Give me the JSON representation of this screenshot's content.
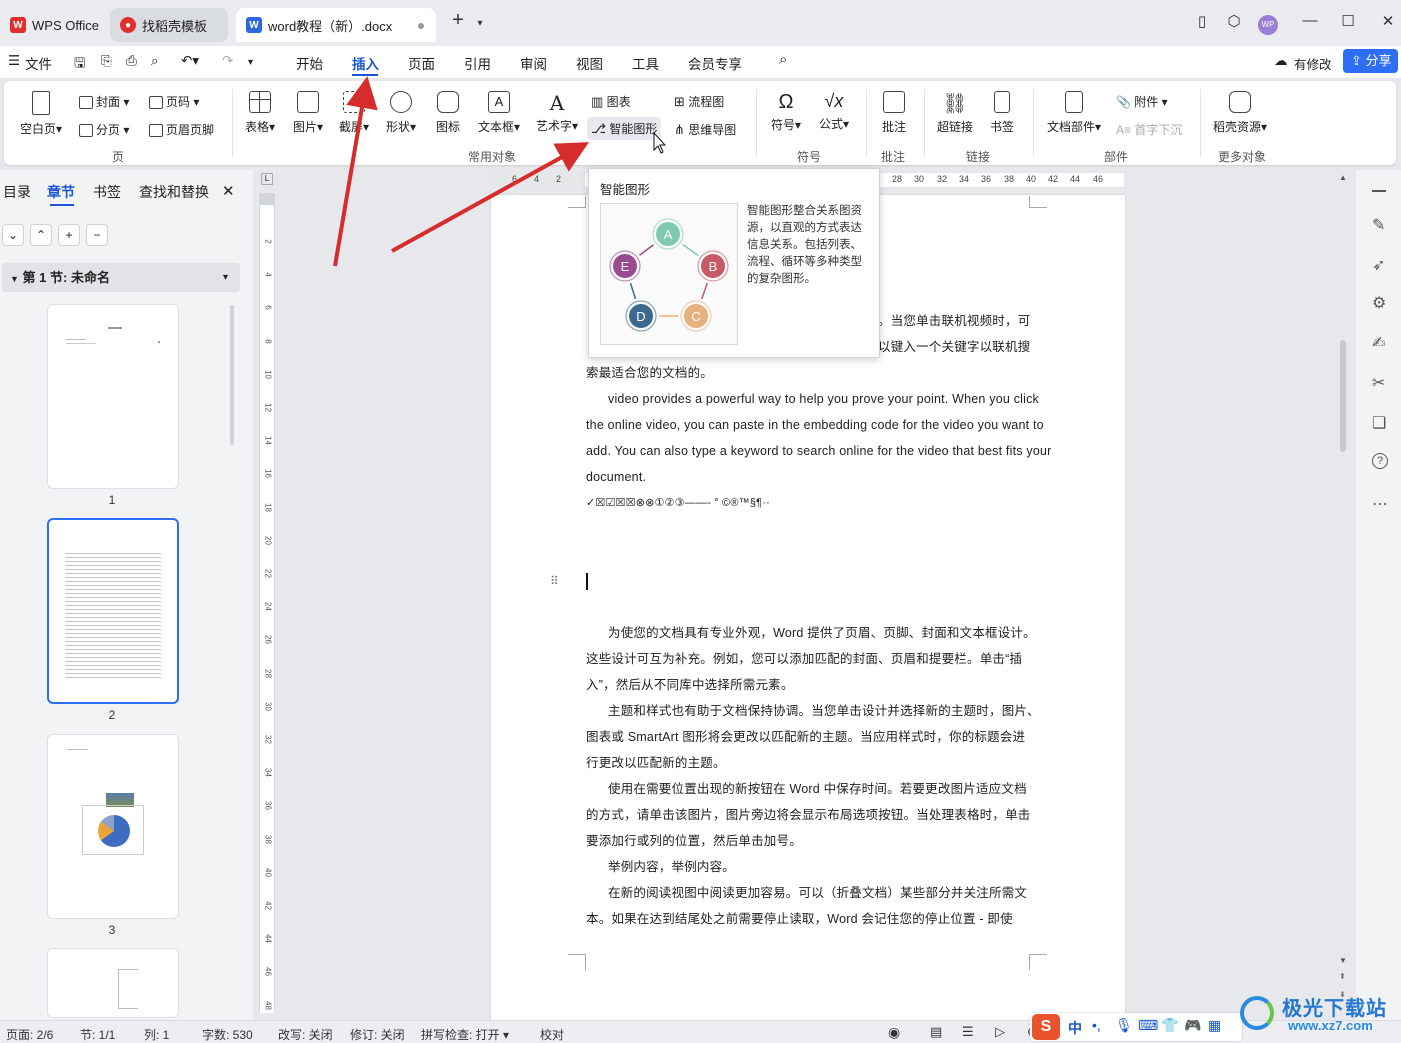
{
  "titlebar": {
    "tabs": [
      {
        "label": "WPS Office"
      },
      {
        "label": "找稻壳模板"
      },
      {
        "label": "word教程（新）.docx"
      }
    ],
    "new_tab": "+",
    "avatar": "WP"
  },
  "menubar": {
    "file": "文件",
    "items": [
      "开始",
      "插入",
      "页面",
      "引用",
      "审阅",
      "视图",
      "工具",
      "会员专享"
    ],
    "active": "插入",
    "modified": "有修改",
    "share": "分享"
  },
  "ribbon": {
    "page_group": {
      "blank": "空白页",
      "cover": "封面",
      "pagebreak": "分页",
      "pagenum": "页码",
      "headerfooter": "页眉页脚",
      "label": "页"
    },
    "common_group": {
      "table": "表格",
      "image": "图片",
      "screenshot": "截屏",
      "shape": "形状",
      "icon": "图标",
      "textbox": "文本框",
      "wordart": "艺术字",
      "chart": "图表",
      "smartart": "智能图形",
      "flowchart": "流程图",
      "mindmap": "思维导图",
      "label": "常用对象"
    },
    "symbol_group": {
      "symbol": "符号",
      "formula": "公式",
      "label": "符号"
    },
    "comment_group": {
      "comment": "批注",
      "label": "批注"
    },
    "link_group": {
      "hyperlink": "超链接",
      "bookmark": "书签",
      "label": "链接"
    },
    "parts_group": {
      "docparts": "文档部件",
      "attachment": "附件",
      "dropcap": "首字下沉",
      "label": "部件"
    },
    "more_group": {
      "resources": "稻壳资源",
      "label": "更多对象"
    }
  },
  "leftpane": {
    "tabs": [
      "目录",
      "章节",
      "书签",
      "查找和替换"
    ],
    "active_tab": "章节",
    "section_title": "第 1 节: 未命名",
    "thumbnails": [
      "1",
      "2",
      "3"
    ]
  },
  "ruler": {
    "h_ticks": [
      "6",
      "4",
      "2",
      "28",
      "30",
      "32",
      "34",
      "36",
      "38",
      "40",
      "42",
      "44",
      "46"
    ],
    "v_ticks": [
      "2",
      "4",
      "6",
      "8",
      "10",
      "12",
      "14",
      "16",
      "18",
      "20",
      "22",
      "24",
      "26",
      "28",
      "30",
      "32",
      "34",
      "36",
      "38",
      "40",
      "42",
      "44",
      "46",
      "48"
    ]
  },
  "tooltip": {
    "title": "智能图形",
    "description": "智能图形整合关系图资源，以直观的方式表达信息关系。包括列表、流程、循环等多种类型的复杂图形。",
    "nodes": [
      {
        "label": "A",
        "color": "#7fc9b3"
      },
      {
        "label": "B",
        "color": "#c75a67"
      },
      {
        "label": "C",
        "color": "#e7b07f"
      },
      {
        "label": "D",
        "color": "#3c6a8f"
      },
      {
        "label": "E",
        "color": "#9a4b8f"
      }
    ]
  },
  "document": {
    "lines_top": [
      "。当您单击联机视频时，可",
      "以键入一个关键字以联机搜",
      "索最适合您的文档的。",
      "video provides a powerful way to help you prove your point. When you click",
      "the online video, you can paste in the embedding code for the video you want to",
      "add. You can also type a keyword to search online for the video that best fits your",
      "document.",
      "✓☒☑☒☒⊗⊗①②③——-  °  ©®™§¶··"
    ],
    "lines_bottom": [
      "为使您的文档具有专业外观，Word  提供了页眉、页脚、封面和文本框设计。",
      "这些设计可互为补充。例如，您可以添加匹配的封面、页眉和提要栏。单击“插",
      "入”，然后从不同库中选择所需元素。",
      "主题和样式也有助于文档保持协调。当您单击设计并选择新的主题时，图片、",
      "图表或  SmartArt  图形将会更改以匹配新的主题。当应用样式时，你的标题会进",
      "行更改以匹配新的主题。",
      "使用在需要位置出现的新按钮在  Word  中保存时间。若要更改图片适应文档",
      "的方式，请单击该图片，图片旁边将会显示布局选项按钮。当处理表格时，单击",
      "要添加行或列的位置，然后单击加号。",
      "举例内容，举例内容。",
      "在新的阅读视图中阅读更加容易。可以（折叠文档）某些部分并关注所需文",
      "本。如果在达到结尾处之前需要停止读取，Word 会记住您的停止位置 - 即使"
    ]
  },
  "statusbar": {
    "page": "页面: 2/6",
    "section": "节: 1/1",
    "column": "列: 1",
    "words": "字数: 530",
    "overtype": "改写: 关闭",
    "revision": "修订: 关闭",
    "spellcheck": "拼写检查: 打开",
    "proofread": "校对",
    "ime": "中",
    "watermark": "极光下载站",
    "watermark_url": "www.xz7.com"
  },
  "colors": {
    "accent": "#1a56d6",
    "annotation_arrow": "#d62c2c"
  }
}
